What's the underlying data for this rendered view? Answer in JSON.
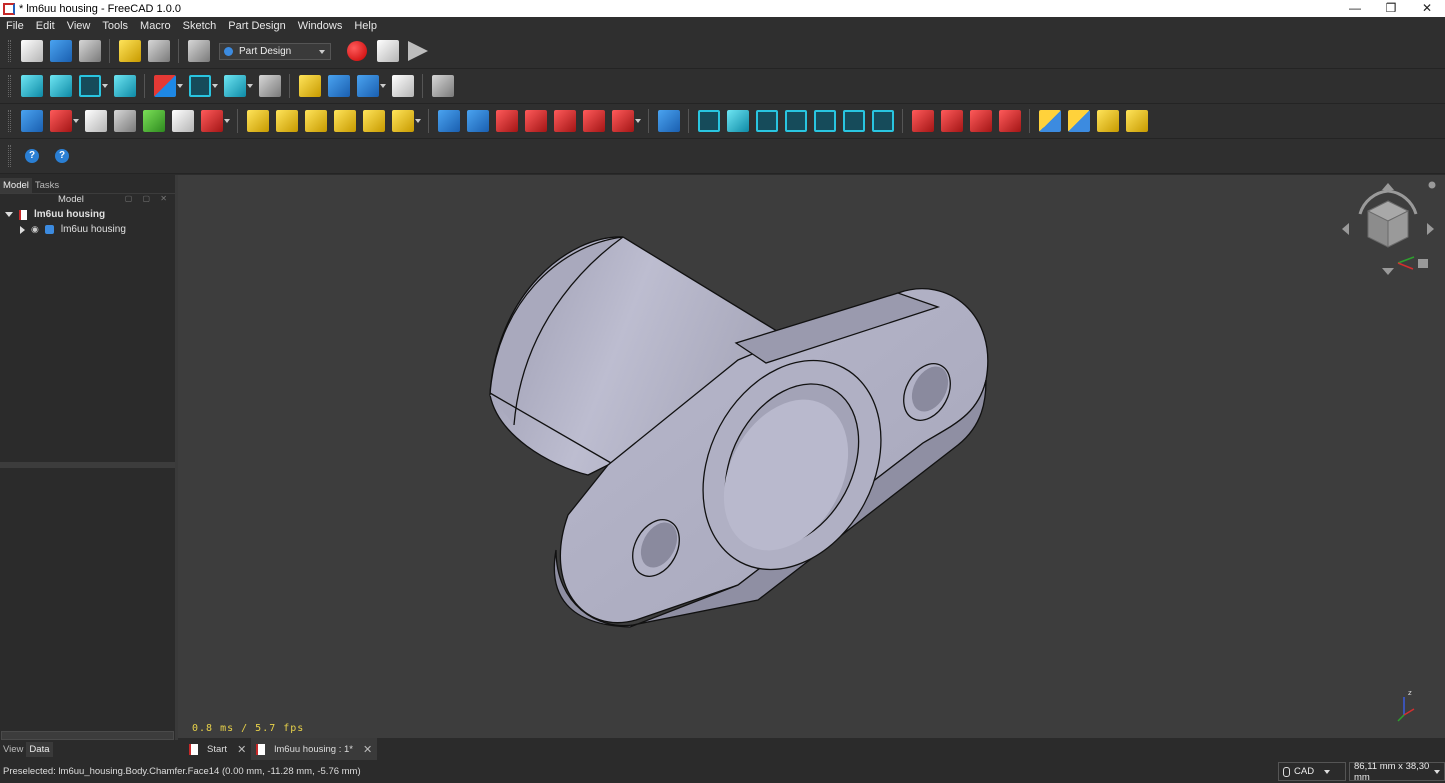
{
  "window": {
    "title": "* lm6uu housing - FreeCAD 1.0.0",
    "controls": [
      "—",
      "❒",
      "✕"
    ]
  },
  "menu": [
    "File",
    "Edit",
    "View",
    "Tools",
    "Macro",
    "Sketch",
    "Part Design",
    "Windows",
    "Help"
  ],
  "workbench": {
    "selected": "Part Design"
  },
  "panel": {
    "tabs": [
      "Model",
      "Tasks"
    ],
    "tree_header": "Model",
    "document": "lm6uu housing",
    "body": "lm6uu housing",
    "bottom_tabs": [
      "View",
      "Data"
    ]
  },
  "viewport": {
    "fps_text": "0.8 ms / 5.7 fps",
    "background": "#3d3d3d",
    "model_color": "#b4b4c8"
  },
  "doc_tabs": [
    {
      "label": "Start",
      "close": "✕"
    },
    {
      "label": "lm6uu housing : 1*",
      "close": "✕"
    }
  ],
  "status": {
    "message": "Preselected: lm6uu_housing.Body.Chamfer.Face14 (0.00 mm, -11.28 mm, -5.76 mm)",
    "navigation_style": "CAD",
    "dimensions": "86,11 mm x 38,30 mm"
  },
  "icons": {
    "help": "?",
    "eye": "◉"
  }
}
